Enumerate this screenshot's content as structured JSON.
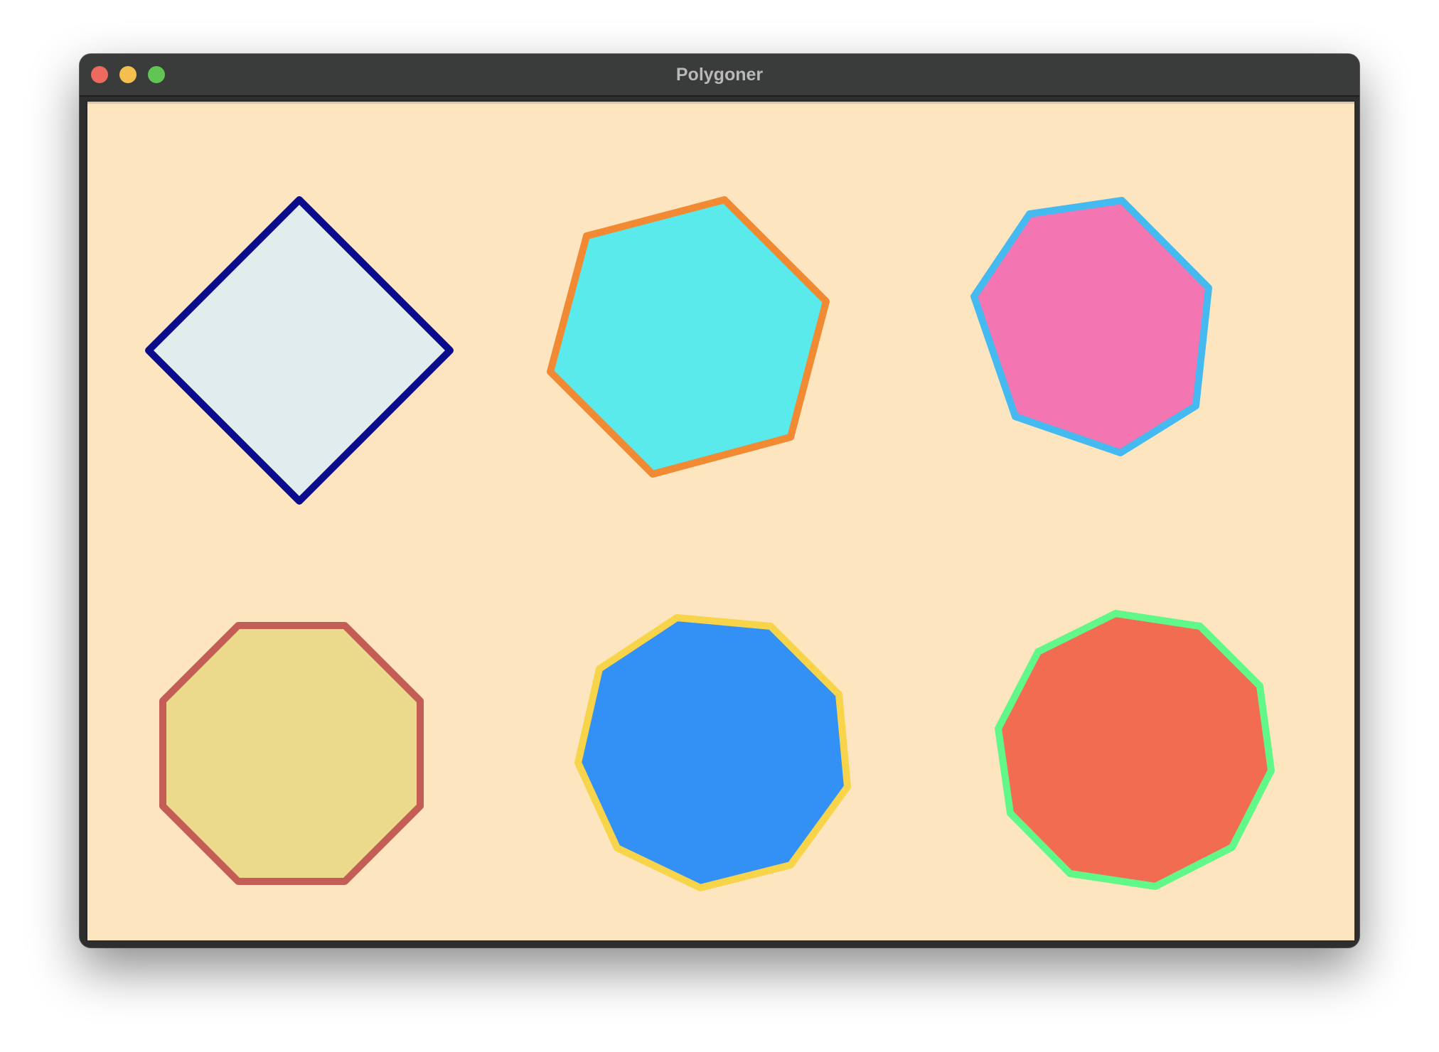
{
  "window": {
    "title": "Polygoner"
  },
  "canvas": {
    "background": "#fde6bf"
  },
  "polygons": [
    {
      "name": "square",
      "sides": 4,
      "fill": "#e1eced",
      "stroke": "#0b0c8c"
    },
    {
      "name": "hexagon",
      "sides": 6,
      "fill": "#5aeaec",
      "stroke": "#f18a33"
    },
    {
      "name": "heptagon",
      "sides": 7,
      "fill": "#f376b2",
      "stroke": "#44baf0"
    },
    {
      "name": "octagon",
      "sides": 8,
      "fill": "#ebd98c",
      "stroke": "#c35d55"
    },
    {
      "name": "nonagon",
      "sides": 9,
      "fill": "#3390f5",
      "stroke": "#f8d44b"
    },
    {
      "name": "decagon",
      "sides": 10,
      "fill": "#f26c51",
      "stroke": "#62f889"
    }
  ]
}
